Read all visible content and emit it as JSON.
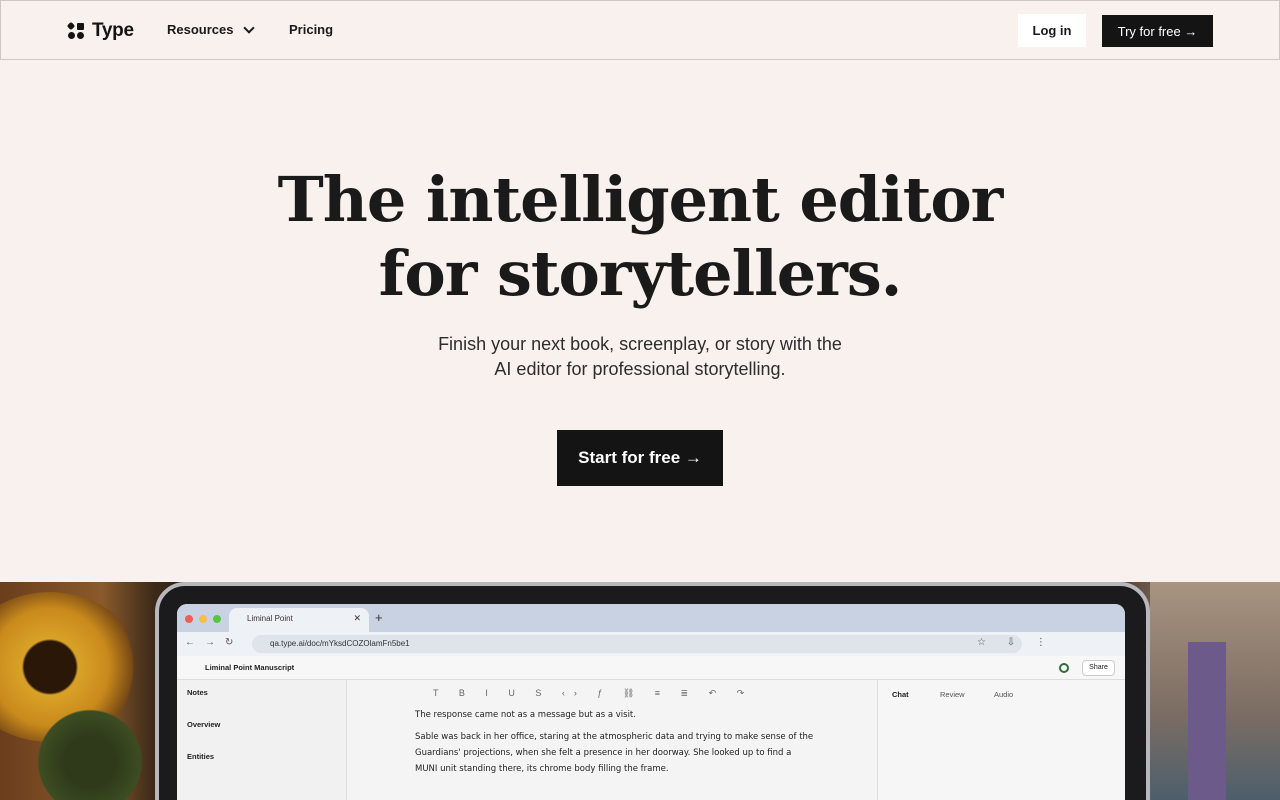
{
  "nav": {
    "brand": "Type",
    "resources": "Resources",
    "pricing": "Pricing",
    "login": "Log in",
    "try": "Try for free →"
  },
  "hero": {
    "title_line1": "The intelligent editor",
    "title_line2": "for storytellers.",
    "sub_line1": "Finish your next book, screenplay, or story with the",
    "sub_line2": "AI editor for professional storytelling.",
    "cta": "Start for free →"
  },
  "app_preview": {
    "tab_title": "Liminal Point",
    "url": "qa.type.ai/doc/mYksdCOZOlamFn5be1",
    "doc_title": "Liminal Point Manuscript",
    "share": "Share",
    "sidebar": {
      "notes": "Notes",
      "overview": "Overview",
      "entities": "Entities"
    },
    "panel_tabs": [
      "Chat",
      "Review",
      "Audio"
    ],
    "text": [
      "The response came not as a message but as a visit.",
      "Sable was back in her office, staring at the atmospheric data and trying to make sense of the Guardians' projections, when she felt a presence in her doorway. She looked up to find a MUNI unit standing there, its chrome body filling the frame."
    ]
  },
  "colors": {
    "background": "#f9f1ed",
    "primary": "#141414"
  }
}
